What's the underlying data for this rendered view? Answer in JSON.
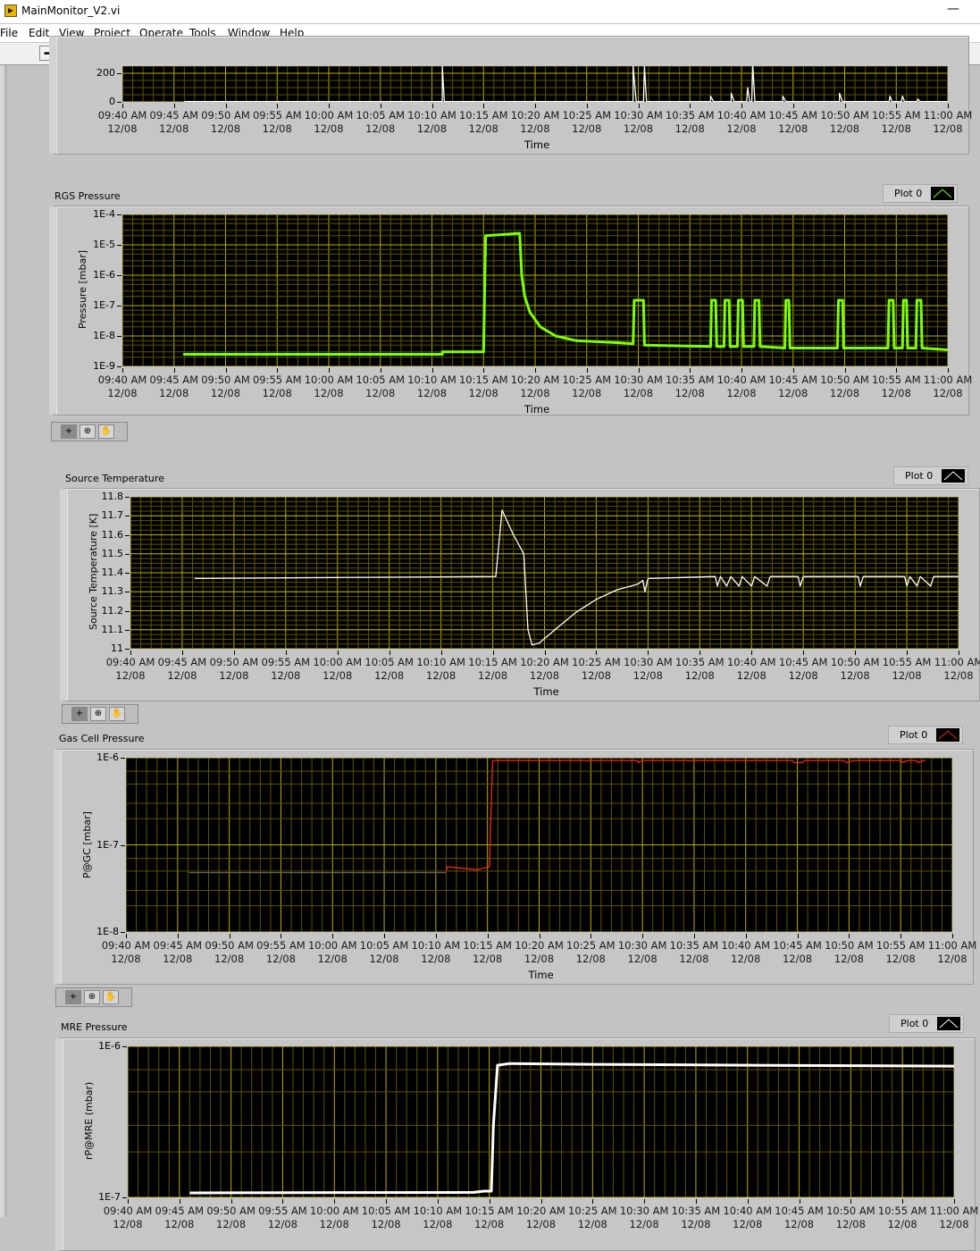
{
  "window": {
    "title": "MainMonitor_V2.vi",
    "minimize": "—"
  },
  "menu": [
    "File",
    "Edit",
    "View",
    "Project",
    "Operate",
    "Tools",
    "Window",
    "Help"
  ],
  "toolbar": {
    "run": "➡",
    "run_continuous": "⟳",
    "abort": "●",
    "pause": "❚❚"
  },
  "palette": {
    "cursor": "+",
    "zoom": "⊕",
    "pan": "✋"
  },
  "x_ticks": {
    "times": [
      "09:40 AM",
      "09:45 AM",
      "09:50 AM",
      "09:55 AM",
      "10:00 AM",
      "10:05 AM",
      "10:10 AM",
      "10:15 AM",
      "10:20 AM",
      "10:25 AM",
      "10:30 AM",
      "10:35 AM",
      "10:40 AM",
      "10:45 AM",
      "10:50 AM",
      "10:55 AM",
      "11:00 AM"
    ],
    "date": "12/08"
  },
  "chart_data": [
    {
      "type": "line",
      "title": "",
      "xlabel": "Time",
      "ylabel": "",
      "legend": "",
      "scale": "linear",
      "ylim": [
        0,
        250
      ],
      "yticks": [
        "200",
        "0"
      ],
      "ytick_values": [
        200,
        0
      ],
      "xlim_minutes_from_0940": [
        0,
        80
      ],
      "color": "#ffffff",
      "series": [
        {
          "name": "Plot 0",
          "points": [
            [
              6,
              2
            ],
            [
              31,
              2
            ],
            [
              31,
              250
            ],
            [
              31.2,
              2
            ],
            [
              49.5,
              2
            ],
            [
              49.5,
              250
            ],
            [
              49.8,
              2
            ],
            [
              50.5,
              2
            ],
            [
              50.6,
              250
            ],
            [
              50.8,
              2
            ],
            [
              57,
              2
            ],
            [
              57,
              40
            ],
            [
              57.3,
              2
            ],
            [
              59,
              2
            ],
            [
              59,
              60
            ],
            [
              59.3,
              2
            ],
            [
              60.5,
              2
            ],
            [
              60.6,
              100
            ],
            [
              60.8,
              2
            ],
            [
              61,
              2
            ],
            [
              61.1,
              250
            ],
            [
              61.3,
              2
            ],
            [
              64,
              2
            ],
            [
              64,
              40
            ],
            [
              64.3,
              2
            ],
            [
              69.5,
              2
            ],
            [
              69.5,
              60
            ],
            [
              69.8,
              2
            ],
            [
              74.3,
              2
            ],
            [
              74.4,
              40
            ],
            [
              74.6,
              2
            ],
            [
              75.5,
              2
            ],
            [
              75.6,
              40
            ],
            [
              75.8,
              2
            ],
            [
              77,
              2
            ],
            [
              77.1,
              20
            ],
            [
              77.3,
              2
            ],
            [
              80,
              2
            ]
          ]
        }
      ]
    },
    {
      "type": "line",
      "title": "RGS Pressure",
      "xlabel": "Time",
      "ylabel": "Pressure [mbar]",
      "legend": "Plot 0",
      "scale": "log",
      "ylim": [
        1e-09,
        0.0001
      ],
      "yticks": [
        "1E-4",
        "1E-5",
        "1E-6",
        "1E-7",
        "1E-8",
        "1E-9"
      ],
      "ytick_values": [
        0.0001,
        1e-05,
        1e-06,
        1e-07,
        1e-08,
        1e-09
      ],
      "xlim_minutes_from_0940": [
        0,
        80
      ],
      "color": "#7cff00",
      "series": [
        {
          "name": "Plot 0",
          "points": [
            [
              5.9,
              2.5e-09
            ],
            [
              31,
              2.5e-09
            ],
            [
              31,
              3e-09
            ],
            [
              35,
              3e-09
            ],
            [
              35.2,
              2e-05
            ],
            [
              37,
              2.2e-05
            ],
            [
              38.5,
              2.4e-05
            ],
            [
              38.7,
              1e-06
            ],
            [
              39,
              2e-07
            ],
            [
              39.5,
              6e-08
            ],
            [
              40.5,
              2e-08
            ],
            [
              42,
              1e-08
            ],
            [
              44,
              7e-09
            ],
            [
              48,
              6e-09
            ],
            [
              49.5,
              5.5e-09
            ],
            [
              49.6,
              1.5e-07
            ],
            [
              50.5,
              1.5e-07
            ],
            [
              50.6,
              5e-09
            ],
            [
              57,
              4.5e-09
            ],
            [
              57.1,
              1.5e-07
            ],
            [
              57.5,
              1.5e-07
            ],
            [
              57.6,
              4.5e-09
            ],
            [
              58.3,
              4.5e-09
            ],
            [
              58.4,
              1.5e-07
            ],
            [
              58.8,
              1.5e-07
            ],
            [
              58.9,
              4.5e-09
            ],
            [
              59.6,
              4.5e-09
            ],
            [
              59.7,
              1.5e-07
            ],
            [
              60.1,
              1.5e-07
            ],
            [
              60.2,
              4.5e-09
            ],
            [
              61.2,
              4.5e-09
            ],
            [
              61.3,
              1.5e-07
            ],
            [
              61.7,
              1.5e-07
            ],
            [
              61.8,
              4.5e-09
            ],
            [
              64.2,
              4e-09
            ],
            [
              64.3,
              1.5e-07
            ],
            [
              64.6,
              1.5e-07
            ],
            [
              64.7,
              4e-09
            ],
            [
              69.3,
              4e-09
            ],
            [
              69.4,
              1.5e-07
            ],
            [
              69.8,
              1.5e-07
            ],
            [
              69.9,
              4e-09
            ],
            [
              74.2,
              4e-09
            ],
            [
              74.3,
              1.5e-07
            ],
            [
              74.7,
              1.5e-07
            ],
            [
              74.8,
              4e-09
            ],
            [
              75.6,
              4e-09
            ],
            [
              75.7,
              1.5e-07
            ],
            [
              76,
              1.5e-07
            ],
            [
              76.1,
              4e-09
            ],
            [
              76.9,
              4e-09
            ],
            [
              77,
              1.5e-07
            ],
            [
              77.4,
              1.5e-07
            ],
            [
              77.5,
              4e-09
            ],
            [
              80,
              3.5e-09
            ]
          ]
        }
      ]
    },
    {
      "type": "line",
      "title": "Source Temperature",
      "xlabel": "Time",
      "ylabel": "Source Temperature [K]",
      "legend": "Plot 0",
      "scale": "linear",
      "ylim": [
        11,
        11.8
      ],
      "yticks": [
        "11.8",
        "11.7",
        "11.6",
        "11.5",
        "11.4",
        "11.3",
        "11.2",
        "11.1",
        "11"
      ],
      "ytick_values": [
        11.8,
        11.7,
        11.6,
        11.5,
        11.4,
        11.3,
        11.2,
        11.1,
        11.0
      ],
      "xlim_minutes_from_0940": [
        0,
        80
      ],
      "color": "#ffffff",
      "series": [
        {
          "name": "Plot 0",
          "points": [
            [
              6.2,
              11.37
            ],
            [
              20,
              11.375
            ],
            [
              35.3,
              11.38
            ],
            [
              35.9,
              11.73
            ],
            [
              37,
              11.6
            ],
            [
              38,
              11.5
            ],
            [
              38.4,
              11.1
            ],
            [
              38.8,
              11.02
            ],
            [
              39.5,
              11.03
            ],
            [
              41,
              11.1
            ],
            [
              43,
              11.19
            ],
            [
              45,
              11.26
            ],
            [
              47,
              11.31
            ],
            [
              49,
              11.34
            ],
            [
              49.5,
              11.36
            ],
            [
              49.7,
              11.3
            ],
            [
              50,
              11.37
            ],
            [
              56.5,
              11.38
            ],
            [
              56.7,
              11.33
            ],
            [
              57,
              11.38
            ],
            [
              57.6,
              11.33
            ],
            [
              58,
              11.38
            ],
            [
              58.8,
              11.33
            ],
            [
              59.1,
              11.38
            ],
            [
              60,
              11.33
            ],
            [
              60.3,
              11.38
            ],
            [
              61.5,
              11.33
            ],
            [
              61.8,
              11.38
            ],
            [
              64.5,
              11.38
            ],
            [
              64.7,
              11.33
            ],
            [
              65,
              11.38
            ],
            [
              70.3,
              11.38
            ],
            [
              70.5,
              11.33
            ],
            [
              70.8,
              11.38
            ],
            [
              74.8,
              11.38
            ],
            [
              75,
              11.33
            ],
            [
              75.3,
              11.38
            ],
            [
              76,
              11.33
            ],
            [
              76.3,
              11.38
            ],
            [
              77.3,
              11.33
            ],
            [
              77.6,
              11.38
            ],
            [
              80,
              11.38
            ]
          ]
        }
      ]
    },
    {
      "type": "line",
      "title": "Gas Cell Pressure",
      "xlabel": "Time",
      "ylabel": "P@GC [mbar]",
      "legend": "Plot 0",
      "scale": "log",
      "ylim": [
        1e-08,
        1e-06
      ],
      "yticks": [
        "1E-6",
        "1E-7",
        "1E-8"
      ],
      "ytick_values": [
        1e-06,
        1e-07,
        1e-08
      ],
      "xlim_minutes_from_0940": [
        0,
        80
      ],
      "color": "#ff2020",
      "series": [
        {
          "name": "gray",
          "color": "#707070",
          "points": [
            [
              6.1,
              4.8e-08
            ],
            [
              31,
              4.8e-08
            ]
          ]
        },
        {
          "name": "Plot 0",
          "points": [
            [
              31,
              5e-08
            ],
            [
              31.1,
              5.6e-08
            ],
            [
              34,
              5.2e-08
            ],
            [
              35.2,
              5.6e-08
            ],
            [
              35.3,
              1.8e-07
            ],
            [
              35.5,
              9.3e-07
            ],
            [
              49.5,
              9.3e-07
            ],
            [
              49.6,
              8.8e-07
            ],
            [
              50,
              9.3e-07
            ],
            [
              64.5,
              9.3e-07
            ],
            [
              64.7,
              8.8e-07
            ],
            [
              65.5,
              8.8e-07
            ],
            [
              65.7,
              9.3e-07
            ],
            [
              69.5,
              9.3e-07
            ],
            [
              69.7,
              8.8e-07
            ],
            [
              70.5,
              9.3e-07
            ],
            [
              75,
              9.3e-07
            ],
            [
              75.2,
              8.8e-07
            ],
            [
              75.6,
              9.3e-07
            ],
            [
              76.5,
              9.3e-07
            ],
            [
              76.7,
              8.8e-07
            ],
            [
              77.2,
              9.3e-07
            ],
            [
              77.4,
              9.3e-07
            ]
          ]
        }
      ]
    },
    {
      "type": "line",
      "title": "MRE Pressure",
      "xlabel": "Time",
      "ylabel": "rP@MRE (mbar)",
      "legend": "Plot 0",
      "scale": "log",
      "ylim": [
        1e-07,
        1e-06
      ],
      "yticks": [
        "1E-6",
        "1E-7"
      ],
      "ytick_values": [
        1e-06,
        1e-07
      ],
      "xlim_minutes_from_0940": [
        0,
        80
      ],
      "color": "#ffffff",
      "series": [
        {
          "name": "Plot 0",
          "points": [
            [
              6,
              1.07e-07
            ],
            [
              33.5,
              1.08e-07
            ],
            [
              34.5,
              1.1e-07
            ],
            [
              35.2,
              1.1e-07
            ],
            [
              35.4,
              3e-07
            ],
            [
              35.8,
              7.5e-07
            ],
            [
              37,
              7.7e-07
            ],
            [
              45,
              7.6e-07
            ],
            [
              60,
              7.5e-07
            ],
            [
              80,
              7.4e-07
            ]
          ]
        }
      ]
    }
  ]
}
